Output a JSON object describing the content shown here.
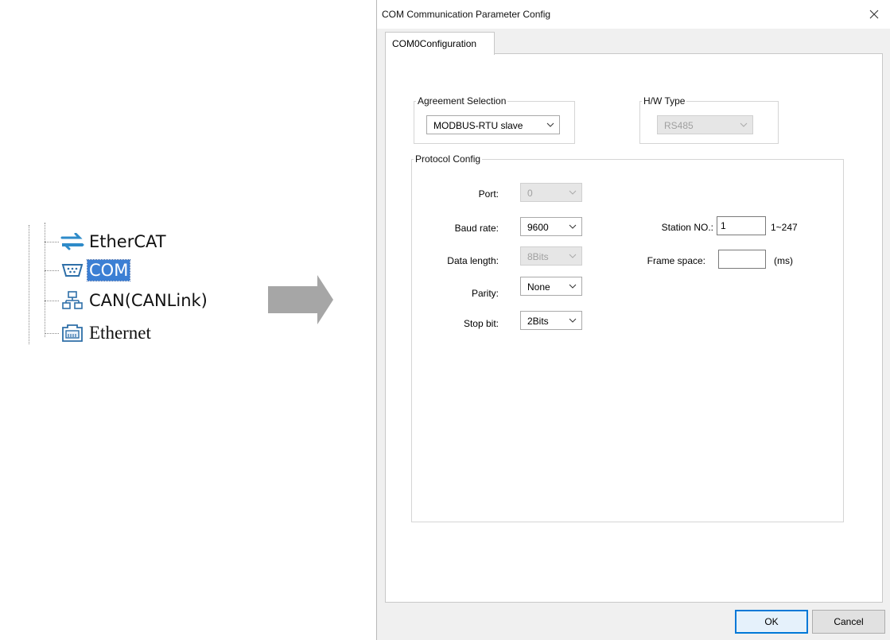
{
  "tree": {
    "items": [
      {
        "label": "EtherCAT",
        "icon": "ethercat-arrows-icon"
      },
      {
        "label": "COM",
        "icon": "serial-port-icon",
        "selected": true
      },
      {
        "label": "CAN(CANLink)",
        "icon": "network-tree-icon"
      },
      {
        "label": "Ethernet",
        "icon": "ethernet-port-icon"
      }
    ]
  },
  "dialog": {
    "title": "COM Communication Parameter Config",
    "tab_label": "COM0Configuration",
    "agreement": {
      "legend": "Agreement Selection",
      "value": "MODBUS-RTU slave"
    },
    "hw": {
      "legend": "H/W Type",
      "value": "RS485"
    },
    "protocol": {
      "legend": "Protocol Config",
      "port": {
        "label": "Port:",
        "value": "0"
      },
      "baud": {
        "label": "Baud rate:",
        "value": "9600"
      },
      "data_length": {
        "label": "Data length:",
        "value": "8Bits"
      },
      "parity": {
        "label": "Parity:",
        "value": "None"
      },
      "stop_bit": {
        "label": "Stop bit:",
        "value": "2Bits"
      },
      "station": {
        "label": "Station NO.:",
        "value": "1",
        "range": "1~247"
      },
      "frame_space": {
        "label": "Frame space:",
        "value": "",
        "unit": "(ms)"
      }
    },
    "buttons": {
      "ok": "OK",
      "cancel": "Cancel"
    }
  },
  "colors": {
    "selection": "#3b7fd4",
    "accent_button": "#0078d7",
    "arrow": "#a6a6a6"
  }
}
